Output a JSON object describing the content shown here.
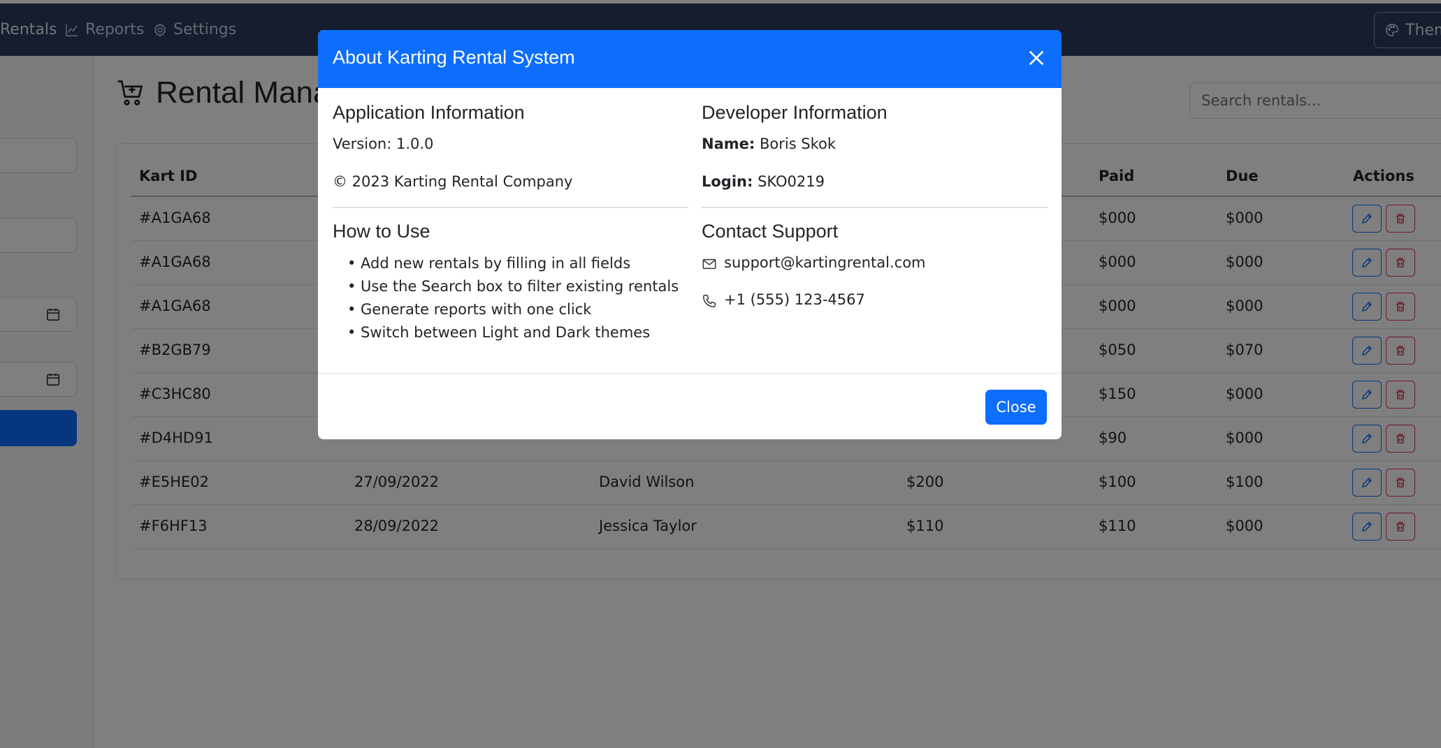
{
  "navbar": {
    "items": [
      {
        "label": "Rentals",
        "icon": "table-icon"
      },
      {
        "label": "Reports",
        "icon": "chart-line-icon"
      },
      {
        "label": "Settings",
        "icon": "gear-icon"
      }
    ],
    "theme_label": "Them"
  },
  "main": {
    "title": "Rental Mana",
    "search_placeholder": "Search rentals..."
  },
  "table": {
    "columns": [
      "Kart ID",
      "Paid",
      "Due",
      "Actions"
    ],
    "rows": [
      {
        "kart_id": "#A1GA68",
        "date": "",
        "customer": "",
        "total": "",
        "paid": "$000",
        "due": "$000"
      },
      {
        "kart_id": "#A1GA68",
        "date": "",
        "customer": "",
        "total": "",
        "paid": "$000",
        "due": "$000"
      },
      {
        "kart_id": "#A1GA68",
        "date": "",
        "customer": "",
        "total": "",
        "paid": "$000",
        "due": "$000"
      },
      {
        "kart_id": "#B2GB79",
        "date": "",
        "customer": "",
        "total": "",
        "paid": "$050",
        "due": "$070"
      },
      {
        "kart_id": "#C3HC80",
        "date": "",
        "customer": "",
        "total": "",
        "paid": "$150",
        "due": "$000"
      },
      {
        "kart_id": "#D4HD91",
        "date": "",
        "customer": "",
        "total": "",
        "paid": "$90",
        "due": "$000"
      },
      {
        "kart_id": "#E5HE02",
        "date": "27/09/2022",
        "customer": "David Wilson",
        "total": "$200",
        "paid": "$100",
        "due": "$100"
      },
      {
        "kart_id": "#F6HF13",
        "date": "28/09/2022",
        "customer": "Jessica Taylor",
        "total": "$110",
        "paid": "$110",
        "due": "$000"
      }
    ]
  },
  "modal": {
    "title": "About Karting Rental System",
    "app_info": {
      "heading": "Application Information",
      "version": "Version: 1.0.0",
      "copyright": "© 2023 Karting Rental Company"
    },
    "dev_info": {
      "heading": "Developer Information",
      "name_label": "Name:",
      "name_value": "Boris Skok",
      "login_label": "Login:",
      "login_value": "SKO0219"
    },
    "how_to": {
      "heading": "How to Use",
      "items": [
        "Add new rentals by filling in all fields",
        "Use the Search box to filter existing rentals",
        "Generate reports with one click",
        "Switch between Light and Dark themes"
      ]
    },
    "support": {
      "heading": "Contact Support",
      "email": "support@kartingrental.com",
      "phone": "+1 (555) 123-4567"
    },
    "close_label": "Close"
  },
  "colors": {
    "navbar": "#2b3a5c",
    "primary": "#0d6efd",
    "danger": "#dc3545"
  }
}
